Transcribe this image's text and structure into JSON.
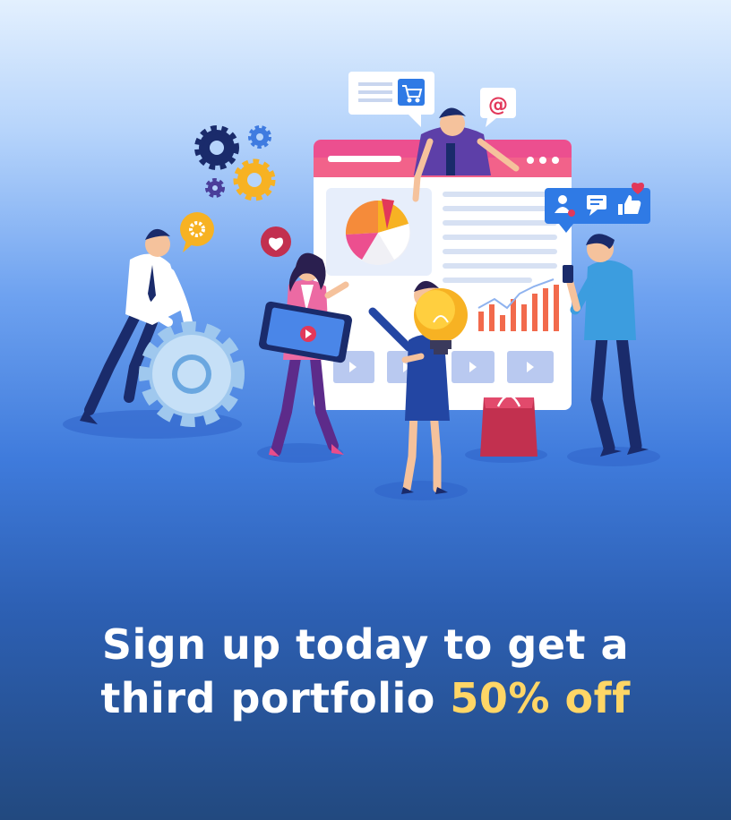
{
  "headline": {
    "line1": "Sign up today to get a",
    "line2_prefix": "third portfolio",
    "line2_highlight": "50% off"
  },
  "colors": {
    "background_top": "#e3f0fe",
    "background_bottom": "#22497f",
    "headline_text": "#ffffff",
    "highlight_text": "#ffd666",
    "accent_pink": "#e94d8b",
    "accent_orange": "#f58b3a"
  },
  "bubbles": {
    "email_symbol": "@"
  },
  "icons": [
    "cart-icon",
    "at-sign-icon",
    "gear-icon",
    "heart-icon",
    "user-icon",
    "chat-icon",
    "thumbs-up-icon",
    "lightbulb-icon",
    "play-icon",
    "shopping-bag-icon"
  ]
}
